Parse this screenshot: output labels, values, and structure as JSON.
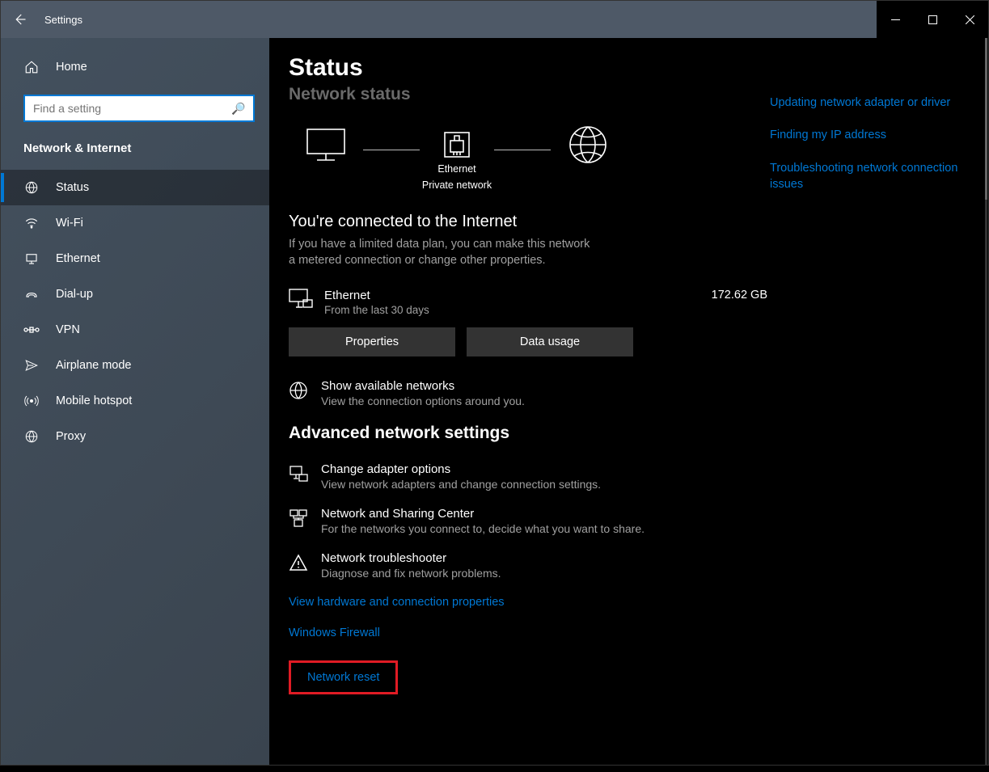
{
  "window": {
    "title": "Settings"
  },
  "sidebar": {
    "home": "Home",
    "search_placeholder": "Find a setting",
    "category": "Network & Internet",
    "items": [
      {
        "label": "Status",
        "icon": "globe"
      },
      {
        "label": "Wi-Fi",
        "icon": "wifi"
      },
      {
        "label": "Ethernet",
        "icon": "ethernet"
      },
      {
        "label": "Dial-up",
        "icon": "dialup"
      },
      {
        "label": "VPN",
        "icon": "vpn"
      },
      {
        "label": "Airplane mode",
        "icon": "airplane"
      },
      {
        "label": "Mobile hotspot",
        "icon": "hotspot"
      },
      {
        "label": "Proxy",
        "icon": "proxy"
      }
    ]
  },
  "main": {
    "title": "Status",
    "subtitle": "Network status",
    "topology": {
      "ethernet_label": "Ethernet",
      "ethernet_sub": "Private network"
    },
    "connected_heading": "You're connected to the Internet",
    "connected_body": "If you have a limited data plan, you can make this network a metered connection or change other properties.",
    "connection": {
      "name": "Ethernet",
      "sub": "From the last 30 days",
      "usage": "172.62 GB"
    },
    "buttons": {
      "properties": "Properties",
      "data_usage": "Data usage"
    },
    "show_networks": {
      "title": "Show available networks",
      "sub": "View the connection options around you."
    },
    "advanced_heading": "Advanced network settings",
    "advanced": [
      {
        "title": "Change adapter options",
        "sub": "View network adapters and change connection settings.",
        "icon": "adapter"
      },
      {
        "title": "Network and Sharing Center",
        "sub": "For the networks you connect to, decide what you want to share.",
        "icon": "share"
      },
      {
        "title": "Network troubleshooter",
        "sub": "Diagnose and fix network problems.",
        "icon": "warn"
      }
    ],
    "links": {
      "hw": "View hardware and connection properties",
      "firewall": "Windows Firewall",
      "reset": "Network reset"
    }
  },
  "related": {
    "l1": "Updating network adapter or driver",
    "l2": "Finding my IP address",
    "l3": "Troubleshooting network connection issues"
  }
}
